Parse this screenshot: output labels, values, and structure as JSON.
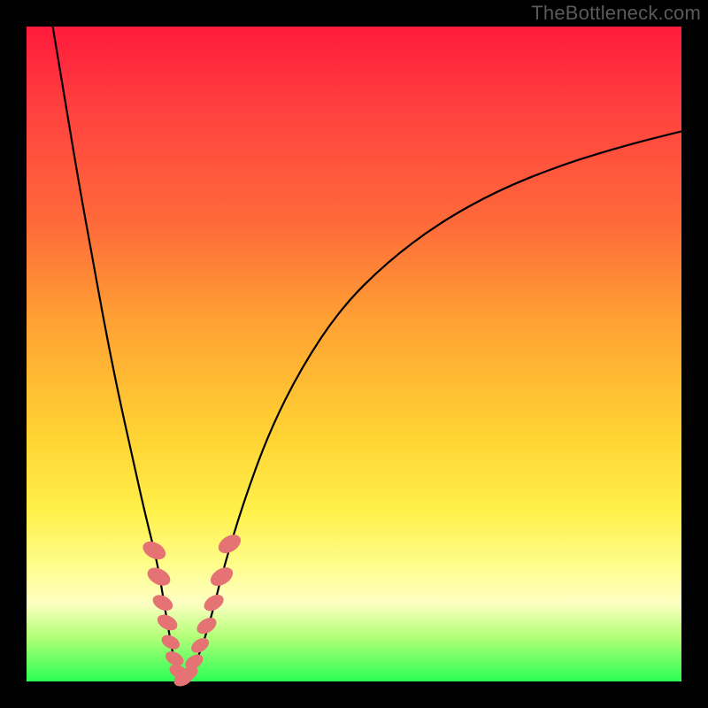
{
  "watermark": "TheBottleneck.com",
  "colors": {
    "frame": "#000000",
    "gradient_top": "#ff1a3c",
    "gradient_bottom": "#2bff55",
    "curve": "#000000",
    "markers": "#e57373"
  },
  "chart_data": {
    "type": "line",
    "title": "",
    "xlabel": "",
    "ylabel": "",
    "xlim": [
      0,
      100
    ],
    "ylim": [
      0,
      100
    ],
    "series": [
      {
        "name": "bottleneck-curve",
        "x": [
          4,
          6,
          8,
          10,
          12,
          14,
          16,
          18,
          20,
          21,
          22,
          23,
          24,
          26,
          28,
          30,
          33,
          37,
          42,
          48,
          55,
          63,
          72,
          82,
          92,
          100
        ],
        "y": [
          100,
          88,
          76,
          65,
          54,
          44,
          35,
          26,
          18,
          12,
          6,
          1,
          0,
          3,
          9,
          17,
          27,
          38,
          48,
          57,
          64,
          70,
          75,
          79,
          82,
          84
        ]
      }
    ],
    "markers": {
      "name": "highlight-points",
      "points": [
        {
          "x": 19.5,
          "y": 20,
          "r": 2.5
        },
        {
          "x": 20.2,
          "y": 16,
          "r": 2.5
        },
        {
          "x": 20.8,
          "y": 12,
          "r": 2.2
        },
        {
          "x": 21.5,
          "y": 9,
          "r": 2.2
        },
        {
          "x": 22.0,
          "y": 6,
          "r": 2.0
        },
        {
          "x": 22.6,
          "y": 3.5,
          "r": 2.0
        },
        {
          "x": 23.2,
          "y": 1.5,
          "r": 2.0
        },
        {
          "x": 24.0,
          "y": 0.5,
          "r": 2.2
        },
        {
          "x": 24.8,
          "y": 1.2,
          "r": 2.0
        },
        {
          "x": 25.6,
          "y": 3.0,
          "r": 2.0
        },
        {
          "x": 26.5,
          "y": 5.5,
          "r": 2.0
        },
        {
          "x": 27.5,
          "y": 8.5,
          "r": 2.2
        },
        {
          "x": 28.6,
          "y": 12,
          "r": 2.2
        },
        {
          "x": 29.8,
          "y": 16,
          "r": 2.5
        },
        {
          "x": 31.0,
          "y": 21,
          "r": 2.5
        }
      ]
    }
  }
}
